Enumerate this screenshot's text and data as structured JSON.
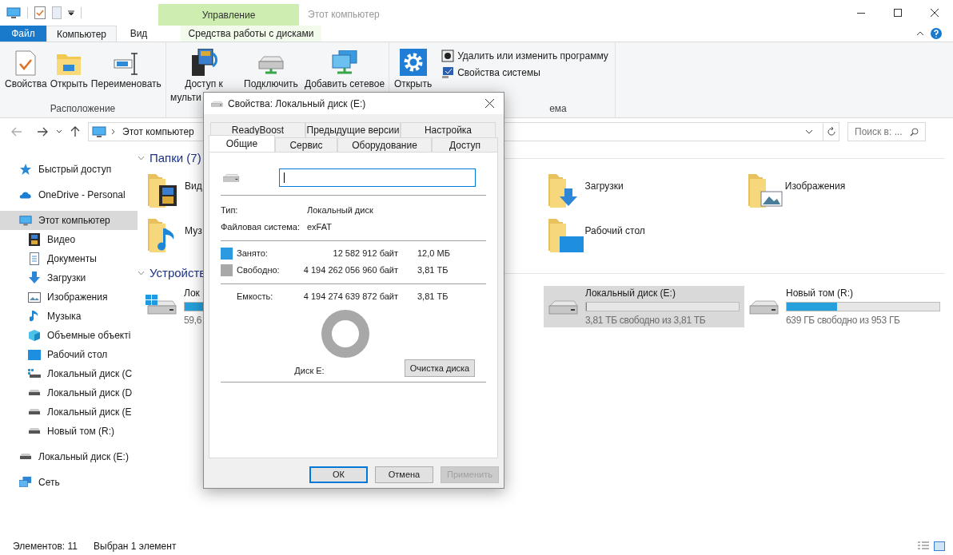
{
  "title_bar": {
    "context_group": "Управление",
    "title": "Этот компьютер"
  },
  "ribbon_tabs": [
    {
      "label": "Файл",
      "kind": "file",
      "selected": false
    },
    {
      "label": "Компьютер",
      "kind": "tab",
      "selected": true
    },
    {
      "label": "Вид",
      "kind": "tab",
      "selected": false
    },
    {
      "label": "Средства работы с дисками",
      "kind": "context",
      "selected": false
    }
  ],
  "ribbon_groups": [
    {
      "label": "Расположение",
      "buttons": [
        {
          "lines": [
            "Свойства"
          ],
          "kind": "properties"
        },
        {
          "lines": [
            "Открыть"
          ],
          "kind": "open-folder"
        },
        {
          "lines": [
            "Переименовать"
          ],
          "kind": "rename"
        }
      ]
    },
    {
      "buttons": [
        {
          "lines": [
            "Доступ к",
            "мульти"
          ],
          "kind": "media"
        },
        {
          "lines": [
            "Подключить"
          ],
          "kind": "drive"
        },
        {
          "lines": [
            "Добавить сетевое"
          ],
          "kind": "network"
        }
      ]
    },
    {
      "label": "ема",
      "buttons": [
        {
          "lines": [
            "Открыть"
          ],
          "kind": "settings"
        }
      ],
      "small_items": [
        "Удалить или изменить программу",
        "Свойства системы"
      ]
    }
  ],
  "address_bar": {
    "path": "Этот компьютер",
    "search_placeholder": "Поиск в: ..."
  },
  "sidebar": {
    "items": [
      {
        "label": "Быстрый доступ",
        "kind": "star",
        "selected": false
      },
      {
        "label": "OneDrive - Personal",
        "kind": "cloud",
        "selected": false
      },
      {
        "label": "Этот компьютер",
        "kind": "pc",
        "selected": true,
        "children": [
          {
            "label": "Видео",
            "kind": "video",
            "selected": false
          },
          {
            "label": "Документы",
            "kind": "docs",
            "selected": false
          },
          {
            "label": "Загрузки",
            "kind": "download",
            "selected": false
          },
          {
            "label": "Изображения",
            "kind": "pictures",
            "selected": false
          },
          {
            "label": "Музыка",
            "kind": "music",
            "selected": false
          },
          {
            "label": "Объемные объекті",
            "kind": "objects",
            "selected": false
          },
          {
            "label": "Рабочий стол",
            "kind": "desktop",
            "selected": false
          },
          {
            "label": "Локальный диск (C",
            "kind": "sysdrive",
            "selected": false
          },
          {
            "label": "Локальный диск (D",
            "kind": "drive",
            "selected": false
          },
          {
            "label": "Локальный диск (E",
            "kind": "drive",
            "selected": false
          },
          {
            "label": "Новый том (R:)",
            "kind": "drive",
            "selected": false
          }
        ]
      },
      {
        "label": "Локальный диск (E:)",
        "kind": "drive",
        "selected": false
      },
      {
        "label": "Сеть",
        "kind": "network",
        "selected": false
      }
    ]
  },
  "folders": {
    "header": "Папки (7)",
    "items": [
      {
        "name": "Вид",
        "kind": "video"
      },
      {
        "name": "Загрузки",
        "kind": "download"
      },
      {
        "name": "Изображения",
        "kind": "pictures"
      },
      {
        "name": "Муз",
        "kind": "music"
      },
      {
        "name": "Рабочий стол",
        "kind": "desktop"
      }
    ]
  },
  "devices": {
    "header": "Устройств",
    "items": [
      {
        "name": "Лок",
        "free": "59,6",
        "kind": "sysdrive",
        "level": 0.8,
        "selected": false
      },
      {
        "name": "Локальный диск (E:)",
        "free": "3,81 ТБ свободно из 3,81 ТБ",
        "kind": "drive",
        "level": 0,
        "selected": true
      },
      {
        "name": "Новый том (R:)",
        "free": "639 ГБ свободно из 953 ГБ",
        "kind": "drive",
        "level": 0.33,
        "selected": false
      }
    ]
  },
  "status_bar": {
    "count": "Элементов: 11",
    "selection": "Выбран 1 элемент"
  },
  "dialog": {
    "title": "Свойства: Локальный диск (E:)",
    "tabs_back": [
      {
        "label": "ReadyBoost",
        "selected": false
      },
      {
        "label": "Предыдущие версии",
        "selected": false
      },
      {
        "label": "Настройка",
        "selected": false
      }
    ],
    "tabs_front": [
      {
        "label": "Общие",
        "selected": true
      },
      {
        "label": "Сервис",
        "selected": false
      },
      {
        "label": "Оборудование",
        "selected": false
      },
      {
        "label": "Доступ",
        "selected": false
      }
    ],
    "info": [
      {
        "label": "Тип:",
        "value": "Локальный диск"
      },
      {
        "label": "Файловая система:",
        "value": "exFAT"
      }
    ],
    "usage": [
      {
        "label": "Занято:",
        "bytes": "12 582 912 байт",
        "size": "12,0 МБ",
        "color": "#2b9ae0"
      },
      {
        "label": "Свободно:",
        "bytes": "4 194 262 056 960 байт",
        "size": "3,81 ТБ",
        "color": "#a8a8a8"
      }
    ],
    "capacity": {
      "label": "Емкость:",
      "bytes": "4 194 274 639 872 байт",
      "size": "3,81 ТБ"
    },
    "drive_label": "Диск E:",
    "cleanup_button": "Очистка диска",
    "buttons": [
      {
        "label": "ОК",
        "kind": "default",
        "disabled": false
      },
      {
        "label": "Отмена",
        "kind": "normal",
        "disabled": false
      },
      {
        "label": "Применить",
        "kind": "normal",
        "disabled": true
      }
    ]
  }
}
